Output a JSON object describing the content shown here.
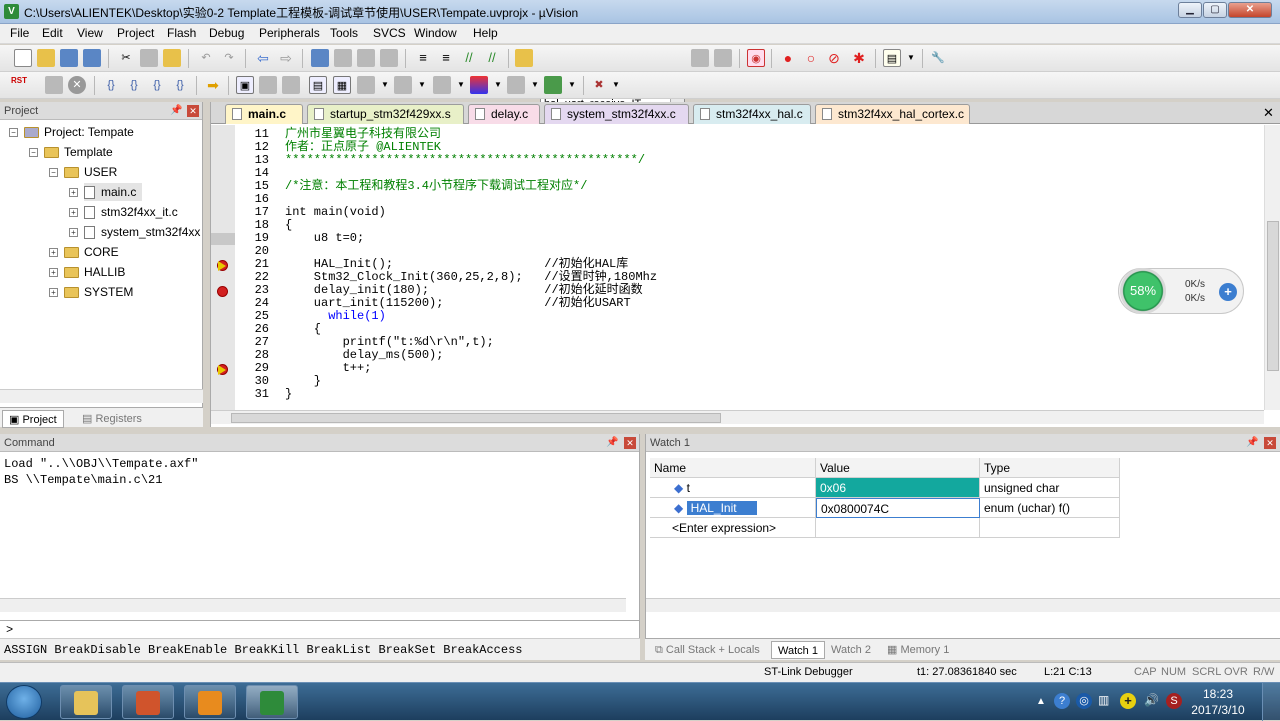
{
  "window": {
    "title": "C:\\Users\\ALIENTEK\\Desktop\\实验0-2 Template工程模板-调试章节使用\\USER\\Tempate.uvprojx - µVision"
  },
  "menu": [
    "File",
    "Edit",
    "View",
    "Project",
    "Flash",
    "Debug",
    "Peripherals",
    "Tools",
    "SVCS",
    "Window",
    "Help"
  ],
  "toolbar": {
    "search_value": "hal_uart_receive_IT",
    "rst_label": "RST"
  },
  "project_panel": {
    "title": "Project",
    "root": "Project: Tempate",
    "target": "Template",
    "groups": [
      {
        "name": "USER",
        "files": [
          "main.c",
          "stm32f4xx_it.c",
          "system_stm32f4xx"
        ]
      },
      {
        "name": "CORE"
      },
      {
        "name": "HALLIB"
      },
      {
        "name": "SYSTEM"
      }
    ],
    "tabs": [
      "Project",
      "Registers"
    ]
  },
  "editor": {
    "tabs": [
      "main.c",
      "startup_stm32f429xx.s",
      "delay.c",
      "system_stm32f4xx.c",
      "stm32f4xx_hal.c",
      "stm32f4xx_hal_cortex.c"
    ],
    "lines": [
      {
        "n": "11",
        "t": "广州市星翼电子科技有限公司"
      },
      {
        "n": "12",
        "t": "作者：正点原子 @ALIENTEK"
      },
      {
        "n": "13",
        "t": "*************************************************/"
      },
      {
        "n": "14",
        "t": ""
      },
      {
        "n": "15",
        "t": "/*注意：本工程和教程3.4小节程序下载调试工程对应*/"
      },
      {
        "n": "16",
        "t": ""
      },
      {
        "n": "17",
        "t": "int main(void)"
      },
      {
        "n": "18",
        "t": "{"
      },
      {
        "n": "19",
        "t": "    u8 t=0;"
      },
      {
        "n": "20",
        "t": ""
      },
      {
        "n": "21",
        "t": "    HAL_Init();                     //初始化HAL库"
      },
      {
        "n": "22",
        "t": "    Stm32_Clock_Init(360,25,2,8);   //设置时钟,180Mhz"
      },
      {
        "n": "23",
        "t": "    delay_init(180);                //初始化延时函数"
      },
      {
        "n": "24",
        "t": "    uart_init(115200);              //初始化USART"
      },
      {
        "n": "25",
        "t": "      while(1)"
      },
      {
        "n": "26",
        "t": "    {"
      },
      {
        "n": "27",
        "t": "        printf(\"t:%d\\r\\n\",t);"
      },
      {
        "n": "28",
        "t": "        delay_ms(500);"
      },
      {
        "n": "29",
        "t": "        t++;"
      },
      {
        "n": "30",
        "t": "    }"
      },
      {
        "n": "31",
        "t": "}"
      }
    ]
  },
  "command_panel": {
    "title": "Command",
    "output": [
      "Load \"..\\\\OBJ\\\\Tempate.axf\"",
      "BS \\\\Tempate\\main.c\\21"
    ],
    "prompt": ">",
    "hints": "ASSIGN BreakDisable BreakEnable BreakKill BreakList BreakSet BreakAccess"
  },
  "watch_panel": {
    "title": "Watch 1",
    "headers": [
      "Name",
      "Value",
      "Type"
    ],
    "rows": [
      {
        "name": "t",
        "value": "0x06",
        "type": "unsigned char"
      },
      {
        "name": "HAL_Init",
        "value": "0x0800074C",
        "type": "enum (uchar) f()"
      }
    ],
    "enter_expr": "<Enter expression>",
    "tabs": [
      "Call Stack + Locals",
      "Watch 1",
      "Watch 2",
      "Memory 1"
    ]
  },
  "status": {
    "debugger": "ST-Link Debugger",
    "time": "t1: 27.08361840 sec",
    "pos": "L:21 C:13",
    "flags": [
      "CAP",
      "NUM",
      "SCRL",
      "OVR",
      "R/W"
    ]
  },
  "net_widget": {
    "percent": "58%",
    "up": "0K/s",
    "down": "0K/s"
  },
  "taskbar": {
    "time": "18:23",
    "date": "2017/3/10"
  },
  "colors": {
    "accent": "#3c7ed0",
    "watch_changed": "#13a89e",
    "breakpoint": "#d22020"
  }
}
